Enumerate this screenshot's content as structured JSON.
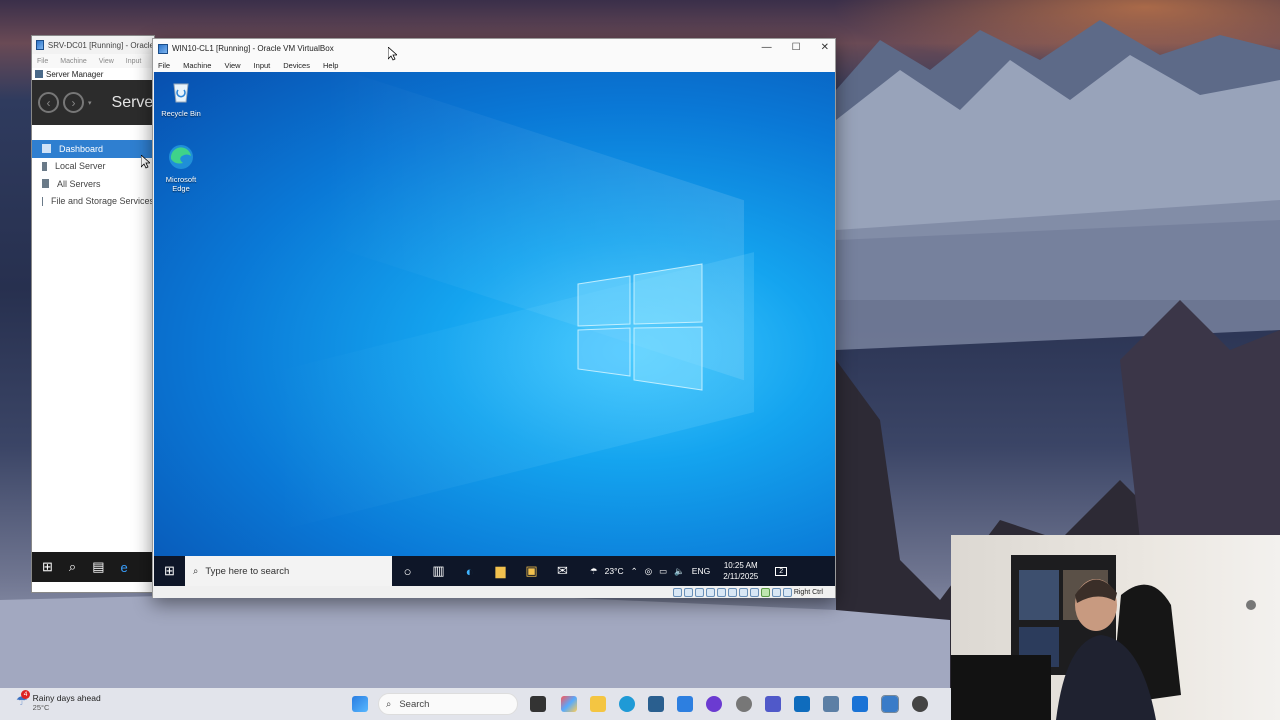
{
  "server_manager": {
    "title": "SRV-DC01 [Running] - Oracle",
    "menu": [
      "File",
      "Machine",
      "View",
      "Input",
      "D"
    ],
    "app_title": "Server Manager",
    "header_title": "Serve",
    "nav_items": [
      {
        "label": "Dashboard",
        "icon": "dashboard-icon",
        "active": true
      },
      {
        "label": "Local Server",
        "icon": "local-server-icon"
      },
      {
        "label": "All Servers",
        "icon": "all-servers-icon"
      },
      {
        "label": "File and Storage Services",
        "icon": "file-storage-icon"
      }
    ]
  },
  "vbox": {
    "title": "WIN10-CL1 [Running] - Oracle VM VirtualBox",
    "menu": [
      "File",
      "Machine",
      "View",
      "Input",
      "Devices",
      "Help"
    ],
    "host_key": "Right Ctrl",
    "desktop_icons": [
      {
        "label": "Recycle Bin",
        "icon": "recycle-bin-icon"
      },
      {
        "label": "Microsoft Edge",
        "icon": "edge-icon"
      }
    ],
    "taskbar": {
      "search_placeholder": "Type here to search",
      "temperature": "23°C",
      "language": "ENG",
      "time": "10:25 AM",
      "date": "2/11/2025",
      "notification_count": "2"
    }
  },
  "host_taskbar": {
    "weather_title": "Rainy days ahead",
    "weather_temp": "25°C",
    "weather_badge": "4",
    "search_placeholder": "Search"
  },
  "colors": {
    "win10_accent": "#0a78d6",
    "server_manager_active": "#2f7fd0"
  }
}
